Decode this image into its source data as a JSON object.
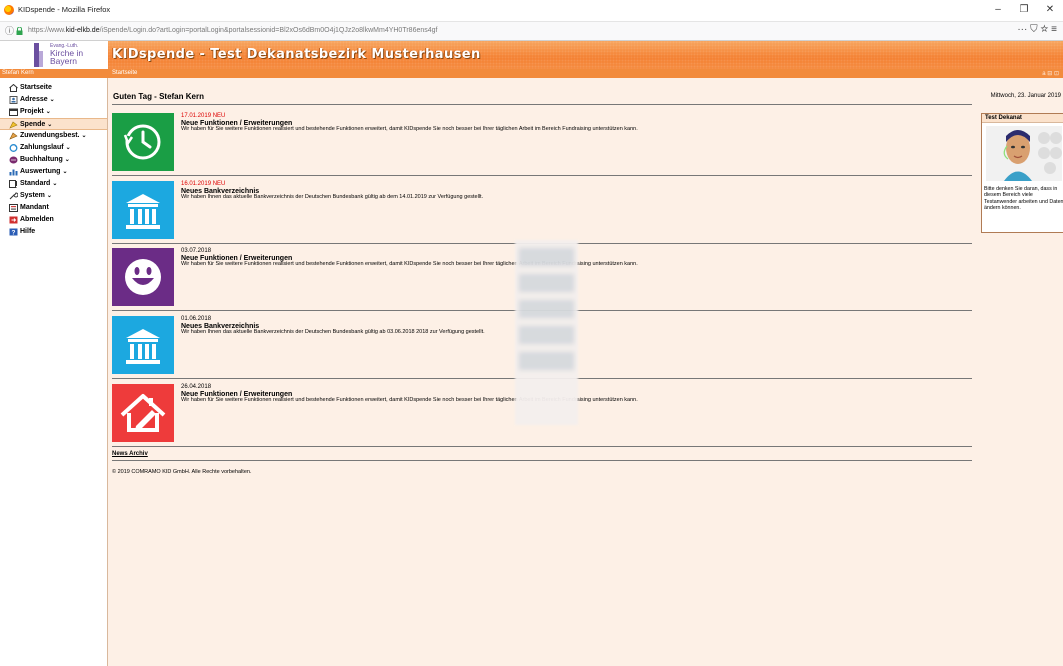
{
  "browser": {
    "window_title": "KIDspende - Mozilla Firefox",
    "url_prefix": "https://www.",
    "url_domain": "kid-elkb.de",
    "url_rest": "/iSpende/Login.do?artLogin=portalLogin&portalsessionid=Bl2xOs6dBm0O4j1QJz2o8lkwMm4YH0Tr86ens4gf",
    "right_icons": "··· ⛉ ☆ ≡"
  },
  "header": {
    "logo_line1": "Evang.-Luth.",
    "logo_line2": "Kirche in",
    "logo_line3": "Bayern",
    "app_title": "KIDspende - Test Dekanatsbezirk Musterhausen"
  },
  "crumbbar": {
    "user": "Stefan Kern",
    "breadcrumb": "Startseite",
    "mini": "a ⊟ ⊡"
  },
  "sidebar": {
    "items": [
      {
        "label": "Startseite",
        "chevron": ""
      },
      {
        "label": "Adresse",
        "chevron": "⌄"
      },
      {
        "label": "Projekt",
        "chevron": "⌄"
      },
      {
        "label": "Spende",
        "chevron": "⌄"
      },
      {
        "label": "Zuwendungsbest.",
        "chevron": "⌄"
      },
      {
        "label": "Zahlungslauf",
        "chevron": "⌄"
      },
      {
        "label": "Buchhaltung",
        "chevron": "⌄"
      },
      {
        "label": "Auswertung",
        "chevron": "⌄"
      },
      {
        "label": "Standard",
        "chevron": "⌄"
      },
      {
        "label": "System",
        "chevron": "⌄"
      },
      {
        "label": "Mandant",
        "chevron": ""
      },
      {
        "label": "Abmelden",
        "chevron": ""
      },
      {
        "label": "Hilfe",
        "chevron": ""
      }
    ]
  },
  "main": {
    "greeting": "Guten Tag - Stefan Kern",
    "date": "Mittwoch, 23. Januar 2019",
    "news": [
      {
        "date": "17.01.2019 NEU",
        "title": "Neue Funktionen / Erweiterungen",
        "text": "Wir haben für Sie weitere Funktionen realisiert und bestehende Funktionen erweitert, damit KIDspende Sie noch besser bei Ihrer täglichen Arbeit im Bereich Fundraising unterstützen kann.",
        "icon": "clock-history-icon",
        "color": "#1a9e45"
      },
      {
        "date": "16.01.2019 NEU",
        "title": "Neues Bankverzeichnis",
        "text": "Wir haben Ihnen das aktuelle Bankverzeichnis der Deutschen Bundesbank gültig ab dem 14.01.2019 zur Verfügung gestellt.",
        "icon": "bank-icon",
        "color": "#1ca8e0"
      },
      {
        "date": "03.07.2018",
        "title": "Neue Funktionen / Erweiterungen",
        "text": "Wir haben für Sie weitere Funktionen realisiert und bestehende Funktionen erweitert, damit KIDspende Sie noch besser bei Ihrer täglichen Arbeit im Bereich Fundraising unterstützen kann.",
        "icon": "smiley-icon",
        "color": "#6b2c86"
      },
      {
        "date": "01.06.2018",
        "title": "Neues Bankverzeichnis",
        "text": "Wir haben Ihnen das aktuelle Bankverzeichnis der Deutschen Bundesbank gültig ab 03.06.2018 2018 zur Verfügung gestellt.",
        "icon": "bank-icon",
        "color": "#1ca8e0"
      },
      {
        "date": "26.04.2018",
        "title": "Neue Funktionen / Erweiterungen",
        "text": "Wir haben für Sie weitere Funktionen realisiert und bestehende Funktionen erweitert, damit KIDspende Sie noch besser bei Ihrer täglichen Arbeit im Bereich Fundraising unterstützen kann.",
        "icon": "house-edit-icon",
        "color": "#ee3b3b"
      }
    ],
    "archive_link": "News Archiv",
    "footer": "© 2019 COMRAMO KID GmbH. Alle Rechte vorbehalten."
  },
  "right_panel": {
    "title": "Test Dekanat",
    "text": "Bitte denken Sie daran, dass in diesem Bereich viele Testanwender arbeiten und Daten ändern können."
  }
}
